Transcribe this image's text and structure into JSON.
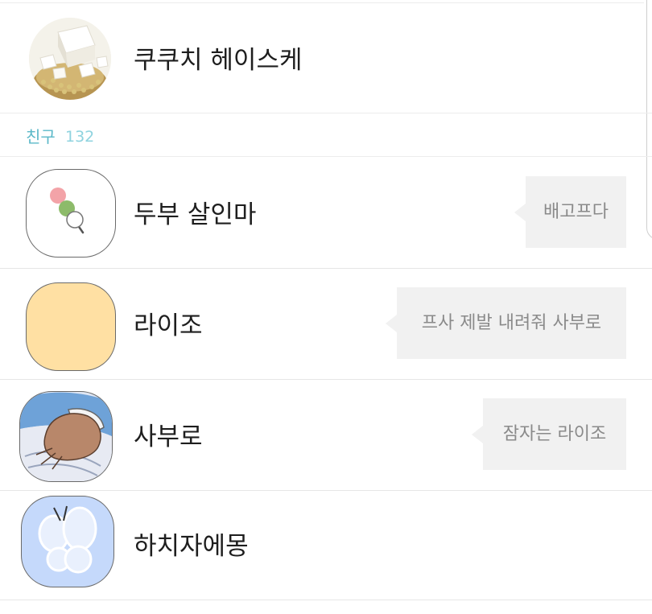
{
  "my_profile": {
    "name": "쿠쿠치 헤이스케"
  },
  "friends_section": {
    "title": "친구",
    "count": "132"
  },
  "friends": [
    {
      "name": "두부 살인마",
      "status": "배고프다",
      "avatar_icon": "dango-icon"
    },
    {
      "name": "라이조",
      "status": "프사 제발 내려줘 사부로",
      "avatar_icon": "blank-avatar"
    },
    {
      "name": "사부로",
      "status": "잠자는 라이조",
      "avatar_icon": "sleeping-person-icon"
    },
    {
      "name": "하치자에몽",
      "status": "",
      "avatar_icon": "butterfly-icon"
    }
  ],
  "colors": {
    "section_accent": "#5bb8c8",
    "bubble_bg": "#f1f1f1"
  }
}
